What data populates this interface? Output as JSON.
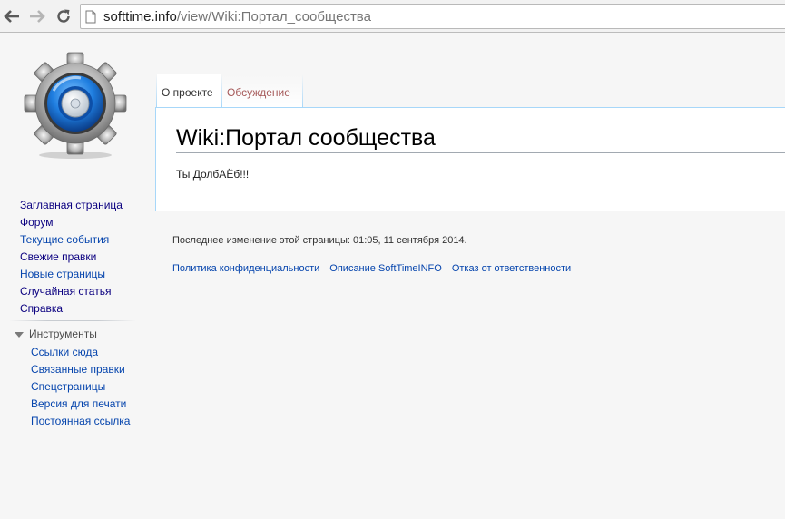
{
  "browser": {
    "url_host": "softtime.info",
    "url_path": "/view/Wiki:Портал_сообщества",
    "icons": {
      "back": "back-arrow-icon",
      "forward": "forward-arrow-icon",
      "reload": "reload-icon",
      "page": "page-icon"
    }
  },
  "site": {
    "logo": "gear-logo"
  },
  "sidebar": {
    "navigation": [
      {
        "label": "Заглавная страница"
      },
      {
        "label": "Форум"
      },
      {
        "label": "Текущие события"
      },
      {
        "label": "Свежие правки"
      },
      {
        "label": "Новые страницы"
      },
      {
        "label": "Случайная статья"
      },
      {
        "label": "Справка"
      }
    ],
    "tools_heading": "Инструменты",
    "tools": [
      {
        "label": "Ссылки сюда"
      },
      {
        "label": "Связанные правки"
      },
      {
        "label": "Спецстраницы"
      },
      {
        "label": "Версия для печати"
      },
      {
        "label": "Постоянная ссылка"
      }
    ]
  },
  "tabs": [
    {
      "label": "О проекте",
      "selected": true
    },
    {
      "label": "Обсуждение",
      "selected": false
    }
  ],
  "page": {
    "title": "Wiki:Портал сообщества",
    "body": "Ты ДолбАЁб!!!"
  },
  "footer": {
    "last_modified": "Последнее изменение этой страницы: 01:05, 11 сентября 2014.",
    "links": [
      {
        "label": "Политика конфиденциальности"
      },
      {
        "label": "Описание SoftTimeINFO"
      },
      {
        "label": "Отказ от ответственности"
      }
    ]
  },
  "colors": {
    "link": "#0645ad",
    "link_unvisited_dark": "#0b0080",
    "tab_discussion": "#a55858",
    "content_border": "#a7d7f9"
  }
}
